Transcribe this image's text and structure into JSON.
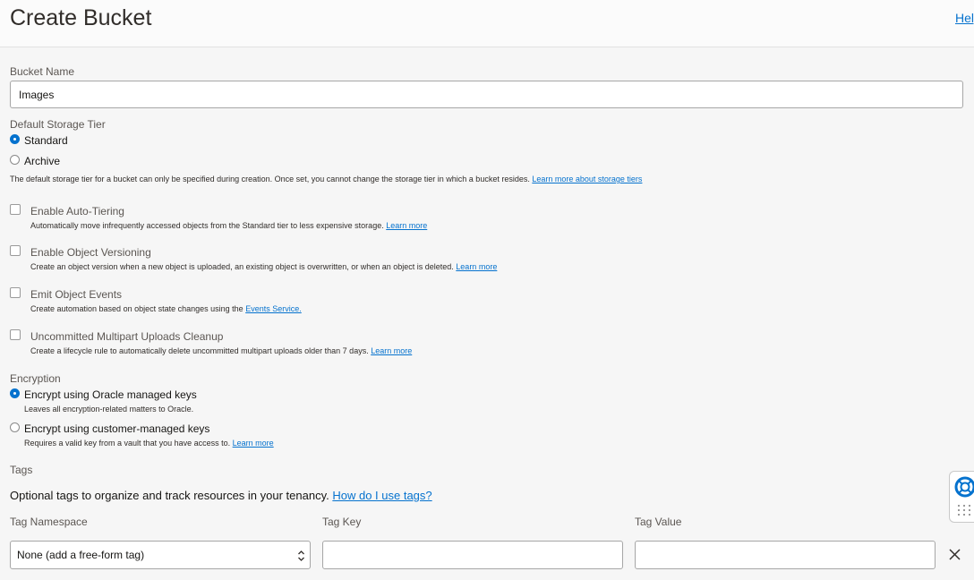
{
  "header": {
    "title": "Create Bucket",
    "help_link": "Help"
  },
  "bucket_name": {
    "label": "Bucket Name",
    "value": "Images"
  },
  "storage_tier": {
    "label": "Default Storage Tier",
    "options": [
      {
        "label": "Standard",
        "selected": true
      },
      {
        "label": "Archive",
        "selected": false
      }
    ],
    "help_text": "The default storage tier for a bucket can only be specified during creation. Once set, you cannot change the storage tier in which a bucket resides.",
    "help_link": "Learn more about storage tiers"
  },
  "options": [
    {
      "label": "Enable Auto-Tiering",
      "checked": false,
      "description": "Automatically move infrequently accessed objects from the Standard tier to less expensive storage.",
      "link": "Learn more"
    },
    {
      "label": "Enable Object Versioning",
      "checked": false,
      "description": "Create an object version when a new object is uploaded, an existing object is overwritten, or when an object is deleted.",
      "link": "Learn more"
    },
    {
      "label": "Emit Object Events",
      "checked": false,
      "description": "Create automation based on object state changes using the",
      "link": "Events Service."
    },
    {
      "label": "Uncommitted Multipart Uploads Cleanup",
      "checked": false,
      "description": "Create a lifecycle rule to automatically delete uncommitted multipart uploads older than 7 days.",
      "link": "Learn more"
    }
  ],
  "encryption": {
    "label": "Encryption",
    "options": [
      {
        "label": "Encrypt using Oracle managed keys",
        "selected": true,
        "description": "Leaves all encryption-related matters to Oracle.",
        "link": ""
      },
      {
        "label": "Encrypt using customer-managed keys",
        "selected": false,
        "description": "Requires a valid key from a vault that you have access to.",
        "link": "Learn more"
      }
    ]
  },
  "tags": {
    "label": "Tags",
    "description": "Optional tags to organize and track resources in your tenancy.",
    "help_link": "How do I use tags?",
    "namespace_label": "Tag Namespace",
    "key_label": "Tag Key",
    "value_label": "Tag Value",
    "namespace_value": "None (add a free-form tag)",
    "key_value": "",
    "value_value": ""
  },
  "icons": {
    "remove_tag": "close-icon",
    "help_widget": "lifebuoy-icon"
  },
  "colors": {
    "accent": "#0572ce",
    "background": "#f6f6f6"
  }
}
